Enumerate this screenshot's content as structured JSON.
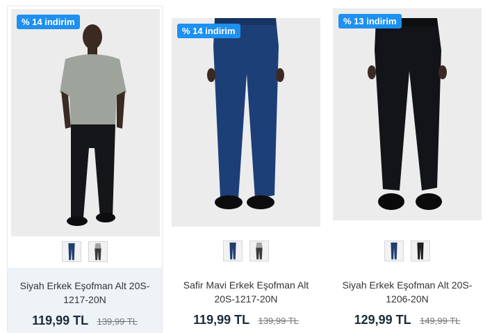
{
  "products": [
    {
      "badge": "% 14 indirim",
      "name": "Siyah Erkek Eşofman Alt 20S-1217-20N",
      "price": "119,99 TL",
      "old_price": "139,99 TL",
      "color": "#141518",
      "thumb_colors": [
        "#1f3f6e",
        "#3a3a3a"
      ]
    },
    {
      "badge": "% 14 indirim",
      "name": "Safir Mavi Erkek Eşofman Alt 20S-1217-20N",
      "price": "119,99 TL",
      "old_price": "139,99 TL",
      "color": "#1d3f78",
      "thumb_colors": [
        "#1f3f6e",
        "#3a3a3a"
      ]
    },
    {
      "badge": "% 13 indirim",
      "name": "Siyah Erkek Eşofman Alt 20S-1206-20N",
      "price": "129,99 TL",
      "old_price": "149,99 TL",
      "color": "#131417",
      "thumb_colors": [
        "#1f3f6e",
        "#202020"
      ]
    }
  ]
}
